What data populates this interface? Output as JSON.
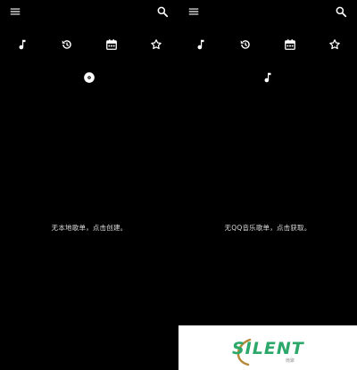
{
  "left_panel": {
    "menu_icon": "menu-icon",
    "search_icon": "search-icon",
    "tabs": [
      {
        "icon": "music-note-icon"
      },
      {
        "icon": "history-icon"
      },
      {
        "icon": "calendar-icon"
      },
      {
        "icon": "star-icon"
      }
    ],
    "indicator_icon": "disc-icon",
    "empty_message": "无本地歌单，点击创建。"
  },
  "right_panel": {
    "menu_icon": "menu-icon",
    "search_icon": "search-icon",
    "tabs": [
      {
        "icon": "music-note-icon"
      },
      {
        "icon": "history-icon"
      },
      {
        "icon": "calendar-icon"
      },
      {
        "icon": "star-icon"
      }
    ],
    "indicator_icon": "music-note-icon",
    "empty_message": "无QQ音乐歌单，点击获取。"
  },
  "watermark": {
    "text": "SILENT",
    "subtext": "微聚",
    "color": "#2ba86a"
  }
}
